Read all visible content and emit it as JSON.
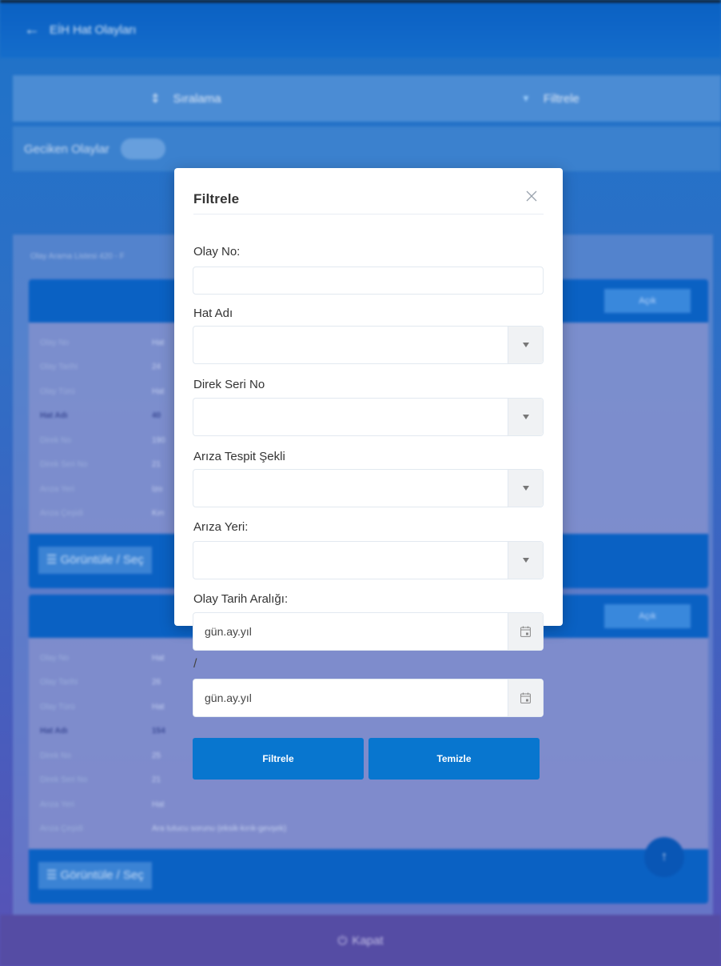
{
  "background_app": {
    "title": "EİH Hat Olayları",
    "sort_label": "Sıralama",
    "filter_label": "Filtrele",
    "delayed_label": "Geciken Olaylar",
    "list_hint": "Olay Arama Listesi 420 - F",
    "cards": [
      {
        "badge": "Açık",
        "rows": [
          {
            "key": "Olay No",
            "value": "Hat"
          },
          {
            "key": "Olay Tarihi",
            "value": "24"
          },
          {
            "key": "Olay Türü",
            "value": "Hat"
          },
          {
            "key": "Hat Adı",
            "value": "40"
          },
          {
            "key": "Direk No",
            "value": "190"
          },
          {
            "key": "Direk Seri No",
            "value": "21"
          },
          {
            "key": "Arıza Yeri",
            "value": "Izo"
          },
          {
            "key": "Arıza Çeşidi",
            "value": "Kırı"
          }
        ],
        "select_label": "Görüntüle / Seç"
      },
      {
        "badge": "Açık",
        "rows": [
          {
            "key": "Olay No",
            "value": "Hat"
          },
          {
            "key": "Olay Tarihi",
            "value": "26"
          },
          {
            "key": "Olay Türü",
            "value": "Hat"
          },
          {
            "key": "Hat Adı",
            "value": "154"
          },
          {
            "key": "Direk No",
            "value": "25"
          },
          {
            "key": "Direk Seri No",
            "value": "21"
          },
          {
            "key": "Arıza Yeri",
            "value": "Hat"
          },
          {
            "key": "Arıza Çeşidi",
            "value": "Ara tutucu sorunu (eksik-kırık-gevşek)"
          }
        ],
        "select_label": "Görüntüle / Seç"
      }
    ],
    "close_label": "Kapat"
  },
  "modal": {
    "title": "Filtrele",
    "labels": {
      "event_no": "Olay No:",
      "line_name": "Hat Adı",
      "pole_serial": "Direk Seri No",
      "fault_detect": "Arıza Tespit Şekli",
      "fault_place": "Arıza Yeri:",
      "date_range": "Olay Tarih Aralığı:"
    },
    "values": {
      "event_no": "",
      "line_name": "",
      "pole_serial": "",
      "fault_detect": "",
      "fault_place": ""
    },
    "date_start": "gün.ay.yıl",
    "date_end": "gün.ay.yıl",
    "range_separator": "/",
    "filter_button": "Filtrele",
    "clear_button": "Temizle"
  },
  "colors": {
    "primary": "#0876cf",
    "header": "#0b63c6",
    "modal_bg": "#ffffff"
  },
  "icons": {
    "back": "arrow-left-icon",
    "close": "close-icon",
    "dropdown": "caret-down-icon",
    "calendar": "calendar-icon",
    "scroll_top": "arrow-up-icon",
    "power": "power-icon"
  }
}
